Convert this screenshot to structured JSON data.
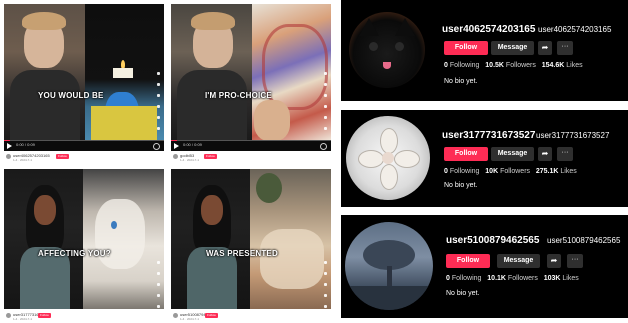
{
  "videos": [
    {
      "overlay": "YOU WOULD BE",
      "username": "user4062574203165",
      "date": "1-4 · 2024-7-1",
      "follow": "Follow",
      "time": "0:00 / 0:09"
    },
    {
      "overlay": "I'M PRO-CHOICE",
      "username": "godbl53",
      "date": "1-4 · 2024-7-1",
      "follow": "Follow",
      "time": "0:00 / 0:09"
    },
    {
      "overlay": "AFFECTING YOU?",
      "username": "user3177731673527",
      "date": "1-4 · 2024-7-1",
      "follow": "Follow",
      "time": "0:00 / 0:09"
    },
    {
      "overlay": "WAS PRESENTED",
      "username": "user5100879462565",
      "date": "1-4 · 2024-7-1",
      "follow": "Follow",
      "time": "0:00 / 0:09"
    }
  ],
  "profiles": [
    {
      "username": "user4062574203165",
      "handle": "user4062574203165",
      "follow": "Follow",
      "message": "Message",
      "following_count": "0",
      "following_label": "Following",
      "followers_count": "10.5K",
      "followers_label": "Followers",
      "likes_count": "154.6K",
      "likes_label": "Likes",
      "bio": "No bio yet.",
      "avatar": "black-cat"
    },
    {
      "username": "user3177731673527",
      "handle": "user3177731673527",
      "follow": "Follow",
      "message": "Message",
      "following_count": "0",
      "following_label": "Following",
      "followers_count": "10K",
      "followers_label": "Followers",
      "likes_count": "275.1K",
      "likes_label": "Likes",
      "bio": "No bio yet.",
      "avatar": "pearl-flower"
    },
    {
      "username": "user5100879462565",
      "handle": "user5100879462565",
      "follow": "Follow",
      "message": "Message",
      "following_count": "0",
      "following_label": "Following",
      "followers_count": "10.1K",
      "followers_label": "Followers",
      "likes_count": "103K",
      "likes_label": "Likes",
      "bio": "No bio yet.",
      "avatar": "misty-tree"
    }
  ],
  "icons": {
    "share": "share-icon",
    "more": "more-icon"
  },
  "colors": {
    "accent": "#fe2c55",
    "card_bg": "#000000",
    "button_bg": "#2f2f2f"
  }
}
